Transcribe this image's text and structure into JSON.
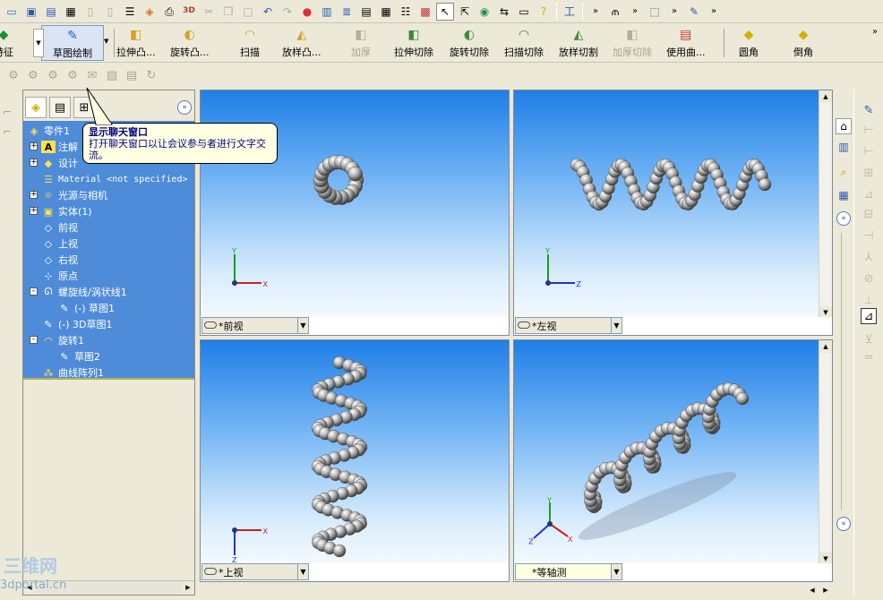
{
  "toolbar_top": {
    "icons": [
      "new-icon",
      "save-icon",
      "save-all-icon",
      "print-icon",
      "doc-icon",
      "doc-icon",
      "report-icon",
      "cube-color-icon",
      "print-preview-icon",
      "3d-icon",
      "cut-icon",
      "copy-icon",
      "paste-icon",
      "undo-icon",
      "redo-icon",
      "traffic-light-icon",
      "view-icon",
      "list-icon",
      "properties-icon",
      "grid-icon",
      "tree-icon",
      "wall-icon",
      "select-arrow-icon",
      "pointer-icon",
      "globe-icon",
      "arrange-icon",
      "window-icon",
      "help-icon"
    ]
  },
  "toolbar_features": {
    "items": [
      {
        "label": "特征",
        "enabled": true,
        "color": "#1e8f2f"
      },
      {
        "label": "草图绘制",
        "enabled": true,
        "color": "#2a5cc8"
      },
      {
        "label": "拉伸凸...",
        "enabled": true,
        "color": "#d4a020"
      },
      {
        "label": "旋转凸...",
        "enabled": true,
        "color": "#d4a020"
      },
      {
        "label": "扫描",
        "enabled": true,
        "color": "#d4a020"
      },
      {
        "label": "放样凸...",
        "enabled": true,
        "color": "#d4a020"
      },
      {
        "label": "加厚",
        "enabled": false,
        "color": "#b0ad9c"
      },
      {
        "label": "拉伸切除",
        "enabled": true,
        "color": "#3a8c3a"
      },
      {
        "label": "旋转切除",
        "enabled": true,
        "color": "#3a8c3a"
      },
      {
        "label": "扫描切除",
        "enabled": true,
        "color": "#3a8c3a"
      },
      {
        "label": "放样切割",
        "enabled": true,
        "color": "#3a8c3a"
      },
      {
        "label": "加厚切除",
        "enabled": false,
        "color": "#b0ad9c"
      },
      {
        "label": "使用曲...",
        "enabled": true,
        "color": "#c0392b"
      },
      {
        "label": "圆角",
        "enabled": true,
        "color": "#d4b000"
      },
      {
        "label": "倒角",
        "enabled": true,
        "color": "#d4b000"
      }
    ]
  },
  "tooltip": {
    "title": "显示聊天窗口",
    "body": "打开聊天窗口以让会议参与者进行文字交流。"
  },
  "feature_tree": {
    "items": [
      {
        "label": "零件1",
        "indent": 0,
        "icon": "part-icon"
      },
      {
        "label": "注解",
        "indent": 1,
        "icon": "annotation-icon",
        "expand": "+"
      },
      {
        "label": "设计",
        "indent": 1,
        "icon": "design-binder-icon",
        "expand": "+"
      },
      {
        "label": "Material <not specified>",
        "indent": 1,
        "icon": "material-icon"
      },
      {
        "label": "光源与相机",
        "indent": 1,
        "icon": "lights-icon",
        "expand": "+"
      },
      {
        "label": "实体(1)",
        "indent": 1,
        "icon": "solid-bodies-icon",
        "expand": "+"
      },
      {
        "label": "前视",
        "indent": 1,
        "icon": "plane-icon"
      },
      {
        "label": "上视",
        "indent": 1,
        "icon": "plane-icon"
      },
      {
        "label": "右视",
        "indent": 1,
        "icon": "plane-icon"
      },
      {
        "label": "原点",
        "indent": 1,
        "icon": "origin-icon"
      },
      {
        "label": "螺旋线/涡状线1",
        "indent": 1,
        "icon": "helix-icon",
        "expand": "-"
      },
      {
        "label": "(-) 草图1",
        "indent": 2,
        "icon": "sketch-icon"
      },
      {
        "label": "(-) 3D草图1",
        "indent": 1,
        "icon": "3d-sketch-icon"
      },
      {
        "label": "旋转1",
        "indent": 1,
        "icon": "revolve-icon",
        "expand": "-"
      },
      {
        "label": "草图2",
        "indent": 2,
        "icon": "sketch-icon"
      },
      {
        "label": "曲线阵列1",
        "indent": 1,
        "icon": "curve-pattern-icon"
      }
    ]
  },
  "viewports": {
    "front": {
      "label": "*前视",
      "axes": [
        "Y",
        "X"
      ]
    },
    "left": {
      "label": "*左视",
      "axes": [
        "Y",
        "Z"
      ]
    },
    "top": {
      "label": "*上视",
      "axes": [
        "Z",
        "X"
      ]
    },
    "iso": {
      "label": "*等轴测",
      "axes": [
        "Y",
        "Z",
        "X"
      ]
    }
  },
  "watermark": {
    "line1": "三维网",
    "line2": "3dportal.cn"
  },
  "colors": {
    "tree_bg": "#4e8bd9",
    "tooltip_bg": "#ffffe1",
    "axis_x": "#cc2222",
    "axis_y": "#229922",
    "axis_z": "#2233cc"
  }
}
